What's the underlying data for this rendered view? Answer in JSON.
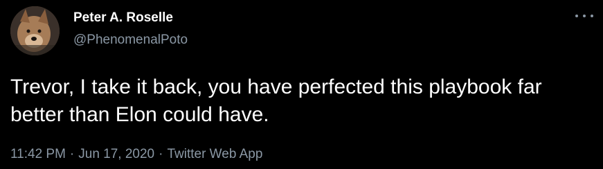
{
  "tweet": {
    "author": {
      "display_name": "Peter A. Roselle",
      "handle": "@PhenomenalPoto",
      "avatar_icon": "dog-avatar"
    },
    "more_icon": "more-horizontal-icon",
    "text": "Trevor, I take it back, you have perfected this playbook far better than Elon could have.",
    "meta": {
      "time": "11:42 PM",
      "separator": "·",
      "date": "Jun 17, 2020",
      "source": "Twitter Web App"
    }
  },
  "colors": {
    "background": "#000000",
    "primary_text": "#ffffff",
    "secondary_text": "#8b98a5"
  }
}
